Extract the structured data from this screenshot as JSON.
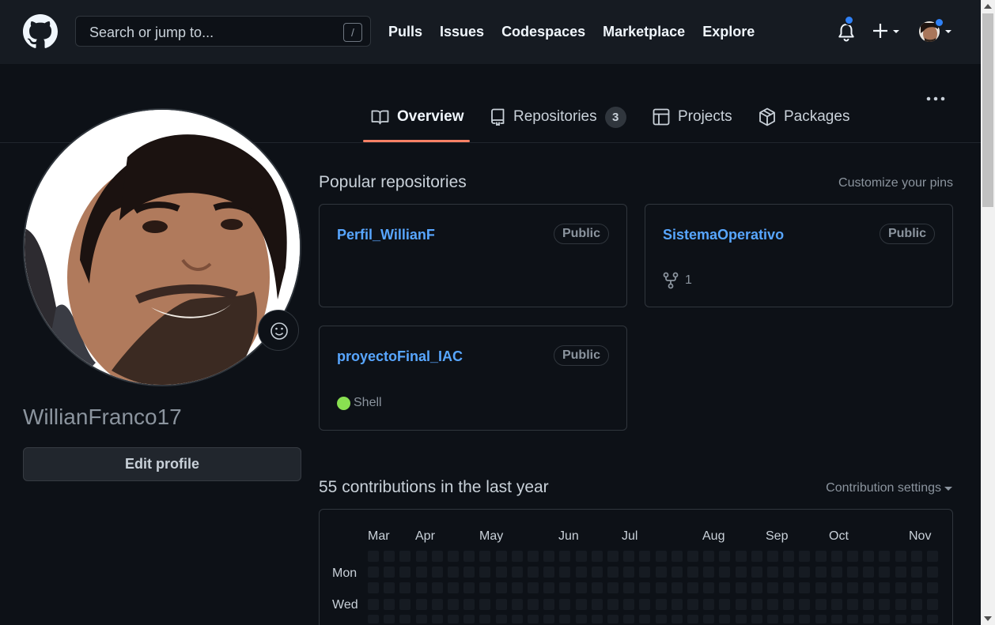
{
  "header": {
    "search_placeholder": "Search or jump to...",
    "search_shortcut": "/",
    "nav": [
      "Pulls",
      "Issues",
      "Codespaces",
      "Marketplace",
      "Explore"
    ]
  },
  "tabs": [
    {
      "label": "Overview",
      "active": true
    },
    {
      "label": "Repositories",
      "count": "3"
    },
    {
      "label": "Projects"
    },
    {
      "label": "Packages"
    }
  ],
  "profile": {
    "username": "WillianFranco17",
    "edit_label": "Edit profile"
  },
  "popular": {
    "title": "Popular repositories",
    "customize_label": "Customize your pins",
    "repos": [
      {
        "name": "Perfil_WillianF",
        "visibility": "Public"
      },
      {
        "name": "SistemaOperativo",
        "visibility": "Public",
        "forks": "1"
      },
      {
        "name": "proyectoFinal_IAC",
        "visibility": "Public",
        "language": "Shell",
        "language_color": "#89e051"
      }
    ]
  },
  "contributions": {
    "title": "55 contributions in the last year",
    "settings_label": "Contribution settings",
    "months": [
      "Mar",
      "Apr",
      "May",
      "Jun",
      "Jul",
      "Aug",
      "Sep",
      "Oct",
      "Nov"
    ],
    "days": [
      "Mon",
      "Wed"
    ]
  },
  "colors": {
    "bg": "#0d1117",
    "header_bg": "#161b22",
    "accent": "#58a6ff",
    "tab_underline": "#f78166",
    "notification_dot": "#2f81f7"
  }
}
